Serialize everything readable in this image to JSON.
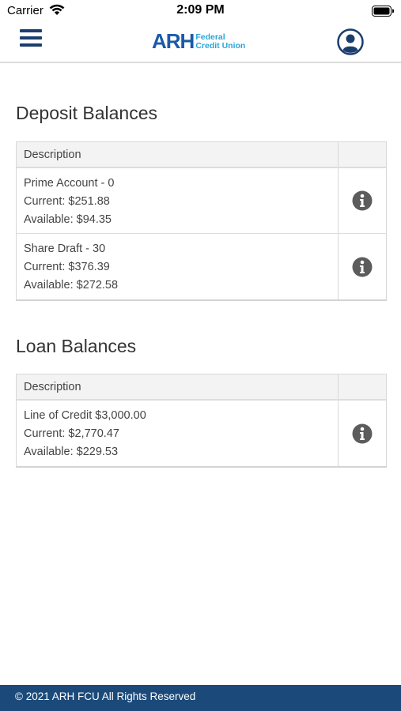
{
  "status_bar": {
    "carrier": "Carrier",
    "time": "2:09 PM"
  },
  "header": {
    "logo_main": "ARH",
    "logo_sub_line1": "Federal",
    "logo_sub_line2": "Credit Union",
    "brand_color": "#1b5aa8",
    "accent_color": "#29a5d9"
  },
  "deposit": {
    "title": "Deposit Balances",
    "column_header": "Description",
    "rows": [
      {
        "name": "Prime Account - 0",
        "current": "Current: $251.88",
        "available": "Available: $94.35",
        "icon": "info-icon"
      },
      {
        "name": "Share Draft - 30",
        "current": "Current: $376.39",
        "available": "Available: $272.58",
        "icon": "info-icon"
      }
    ]
  },
  "loan": {
    "title": "Loan Balances",
    "column_header": "Description",
    "rows": [
      {
        "name": "Line of Credit $3,000.00",
        "current": "Current: $2,770.47",
        "available": "Available: $229.53",
        "icon": "info-icon"
      }
    ]
  },
  "footer": {
    "text": "© 2021 ARH FCU All Rights Reserved",
    "color": "#1b4a7a"
  }
}
